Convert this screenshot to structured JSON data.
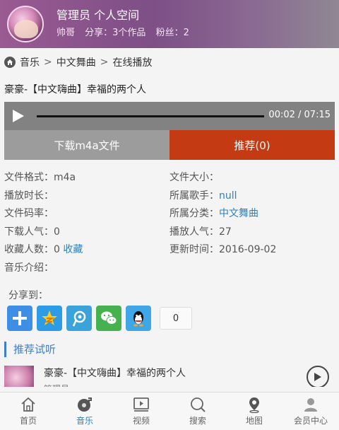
{
  "header": {
    "title": "管理员 个人空间",
    "nick": "帅哥",
    "share": "分享：3个作品",
    "fans": "粉丝：2"
  },
  "breadcrumb": {
    "items": [
      "音乐",
      "中文舞曲",
      "在线播放"
    ],
    "sep": ">"
  },
  "song": {
    "title": "豪豪-【中文嗨曲】幸福的两个人",
    "time": "00:02 / 07:15",
    "progress": 0.005
  },
  "actions": {
    "download": "下载m4a文件",
    "recommend": "推荐(0)"
  },
  "info": {
    "format_label": "文件格式：",
    "format": "m4a",
    "size_label": "文件大小：",
    "size": "",
    "duration_label": "播放时长：",
    "duration": "",
    "singer_label": "所属歌手：",
    "singer": "null",
    "bitrate_label": "文件码率：",
    "bitrate": "",
    "category_label": "所属分类：",
    "category": "中文舞曲",
    "downloads_label": "下载人气：",
    "downloads": "0",
    "plays_label": "播放人气：",
    "plays": "27",
    "favs_label": "收藏人数：",
    "favs": "0",
    "fav_link": "收藏",
    "updated_label": "更新时间：",
    "updated": "2016-09-02",
    "intro_label": "音乐介绍："
  },
  "share": {
    "label": "分享到：",
    "count": "0"
  },
  "recommend": {
    "heading": "推荐试听",
    "items": [
      {
        "title": "豪豪-【中文嗨曲】幸福的两个人",
        "sub": "管理员"
      }
    ]
  },
  "tabbar": {
    "items": [
      "首页",
      "音乐",
      "视频",
      "搜索",
      "地图",
      "会员中心"
    ]
  },
  "colors": {
    "accent": "#2f7fc1",
    "recommend_btn": "#c43a12",
    "download_btn": "#9c9c9c"
  }
}
